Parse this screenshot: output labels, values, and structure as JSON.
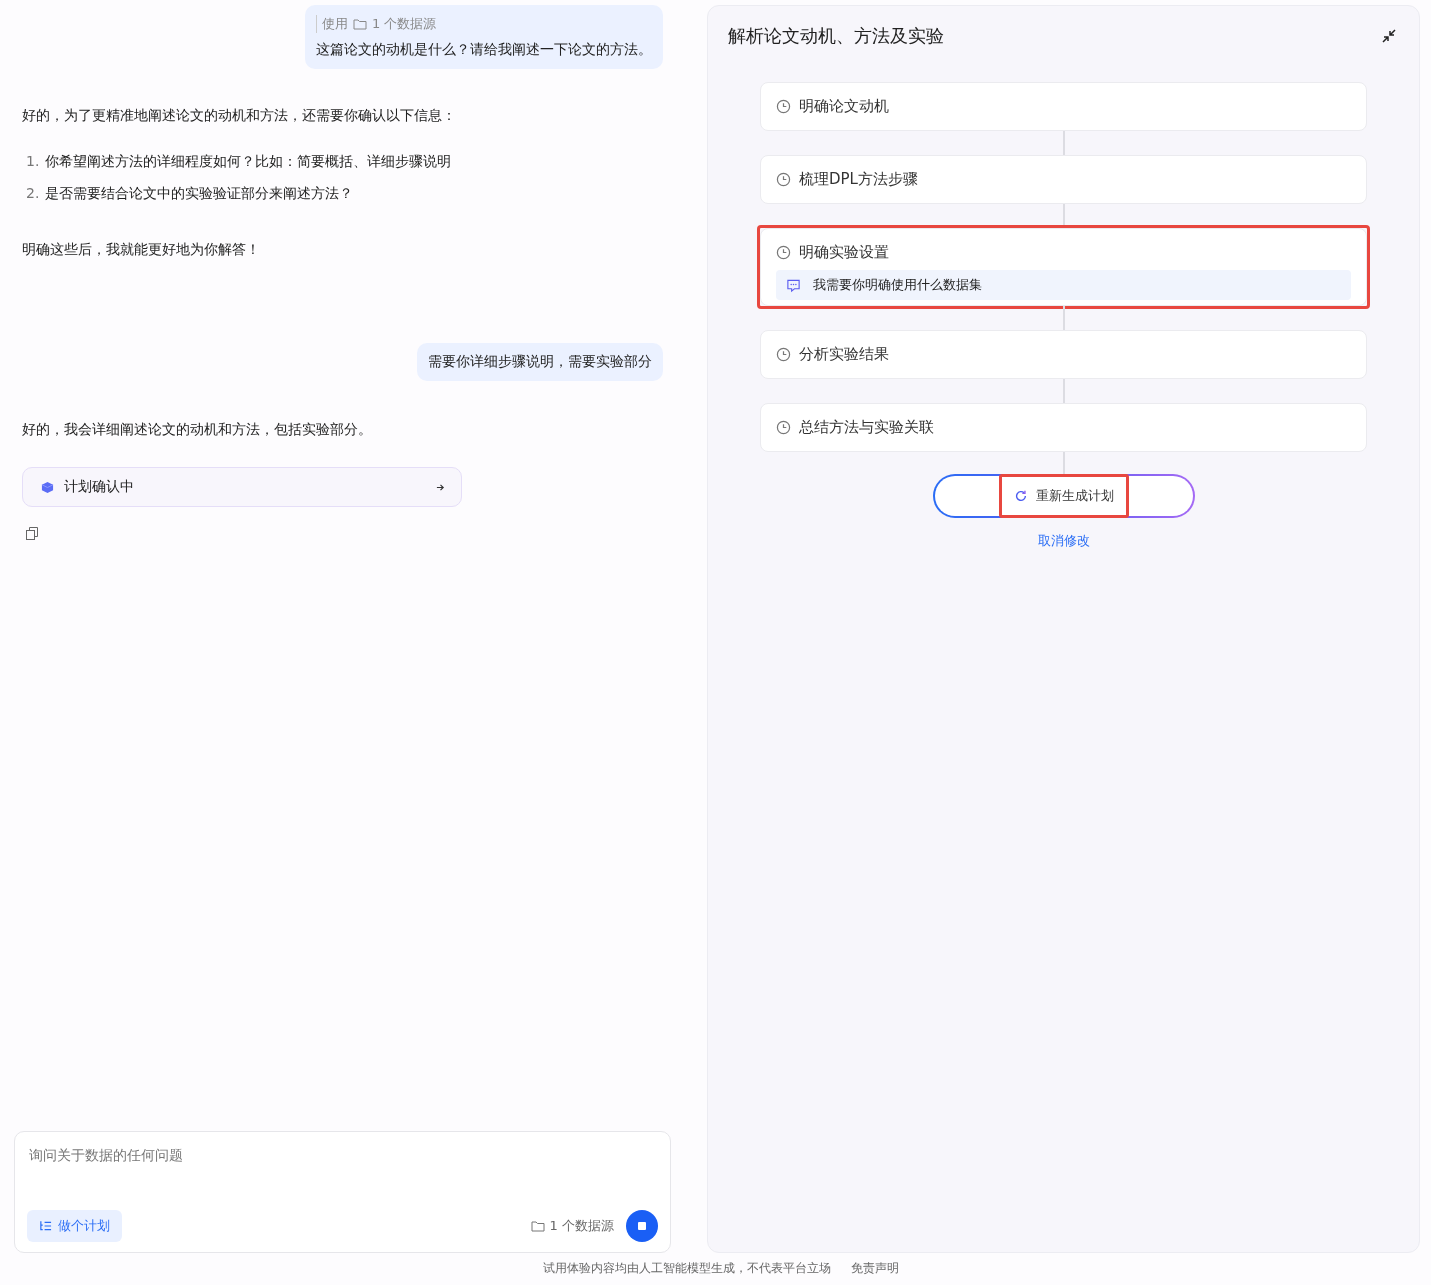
{
  "chat": {
    "messages": [
      {
        "kind": "user",
        "source_prefix": "使用",
        "source_label": "1 个数据源",
        "text": "这篇论文的动机是什么？请给我阐述一下论文的方法。"
      },
      {
        "kind": "assistant",
        "intro": "好的，为了更精准地阐述论文的动机和方法，还需要你确认以下信息：",
        "list": [
          {
            "number": "1.",
            "text": "你希望阐述方法的详细程度如何？比如：简要概括、详细步骤说明"
          },
          {
            "number": "2.",
            "text": "是否需要结合论文中的实验验证部分来阐述方法？"
          }
        ],
        "outro": "明确这些后，我就能更好地为你解答！"
      },
      {
        "kind": "user",
        "text": "需要你详细步骤说明，需要实验部分"
      },
      {
        "kind": "assistant",
        "intro": "好的，我会详细阐述论文的动机和方法，包括实验部分。",
        "plan_card": {
          "label": "计划确认中"
        },
        "copy": true
      }
    ]
  },
  "input": {
    "placeholder": "询问关于数据的任何问题",
    "plan_button": "做个计划",
    "source_label": "1 个数据源"
  },
  "plan_panel": {
    "title": "解析论文动机、方法及实验",
    "steps": [
      {
        "label": "明确论文动机",
        "highlighted": false
      },
      {
        "label": "梳理DPL方法步骤",
        "highlighted": false
      },
      {
        "label": "明确实验设置",
        "highlighted": true,
        "note": "我需要你明确使用什么数据集"
      },
      {
        "label": "分析实验结果",
        "highlighted": false
      },
      {
        "label": "总结方法与实验关联",
        "highlighted": false
      }
    ],
    "regenerate_button": {
      "label": "重新生成计划",
      "highlighted": true
    },
    "cancel_link": "取消修改"
  },
  "footer": {
    "disclaimer": "试用体验内容均由人工智能模型生成，不代表平台立场",
    "link": "免责声明"
  }
}
